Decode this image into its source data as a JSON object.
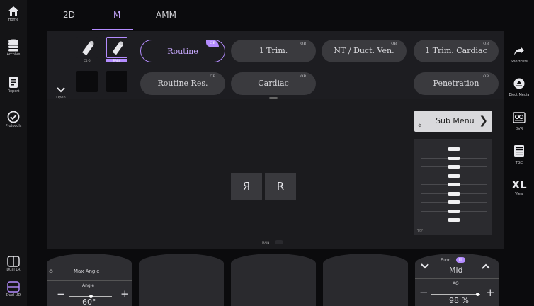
{
  "left_nav": [
    {
      "label": "Home",
      "icon": "home-icon"
    },
    {
      "label": "Archive",
      "icon": "database-icon"
    },
    {
      "label": "Report",
      "icon": "report-icon"
    },
    {
      "label": "Protocols",
      "icon": "check-circle-icon"
    },
    {
      "label": "Dual LR",
      "icon": "dual-lr-icon"
    },
    {
      "label": "Dual UD",
      "icon": "dual-ud-icon"
    }
  ],
  "right_nav": [
    {
      "label": "Shortcuts",
      "icon": "arrow-icon"
    },
    {
      "label": "Eject Media",
      "icon": "eject-icon"
    },
    {
      "label": "DVR",
      "icon": "dvr-icon"
    },
    {
      "label": "TGC",
      "icon": "tgc-icon"
    },
    {
      "label": "View",
      "value": "XL"
    }
  ],
  "tabs": [
    {
      "label": "2D"
    },
    {
      "label": "M"
    },
    {
      "label": "AMM"
    }
  ],
  "probes": [
    {
      "label": "C1-5"
    },
    {
      "label": "RAB6"
    }
  ],
  "open_label": "Open",
  "presets": [
    {
      "label": "Routine",
      "badge": "OB"
    },
    {
      "label": "1 Trim.",
      "badge": "OB"
    },
    {
      "label": "NT / Duct. Ven.",
      "badge": "OB"
    },
    {
      "label": "1 Trim. Cardiac",
      "badge": "OB"
    },
    {
      "label": "Routine Res.",
      "badge": "OB"
    },
    {
      "label": "Cardiac",
      "badge": "OB"
    },
    {
      "label": "Penetration",
      "badge": "OB"
    }
  ],
  "orientation": {
    "left": "Я",
    "right": "R"
  },
  "main_label": "MAIN",
  "submenu": {
    "label": "Sub Menu"
  },
  "tgc": {
    "label": "TGC",
    "levels": [
      0.5,
      0.5,
      0.5,
      0.5,
      0.5,
      0.5,
      0.5,
      0.5,
      0.5
    ]
  },
  "controls": {
    "max_angle_label": "Max Angle",
    "angle_label": "Angle",
    "angle_value": "60°",
    "fund_label": "Fund.",
    "hi_badge": "HI",
    "fund_value": "Mid",
    "ao_label": "AO",
    "ao_value": "98 %"
  },
  "colors": {
    "accent": "#b48cff",
    "panel": "#1d1d21"
  }
}
